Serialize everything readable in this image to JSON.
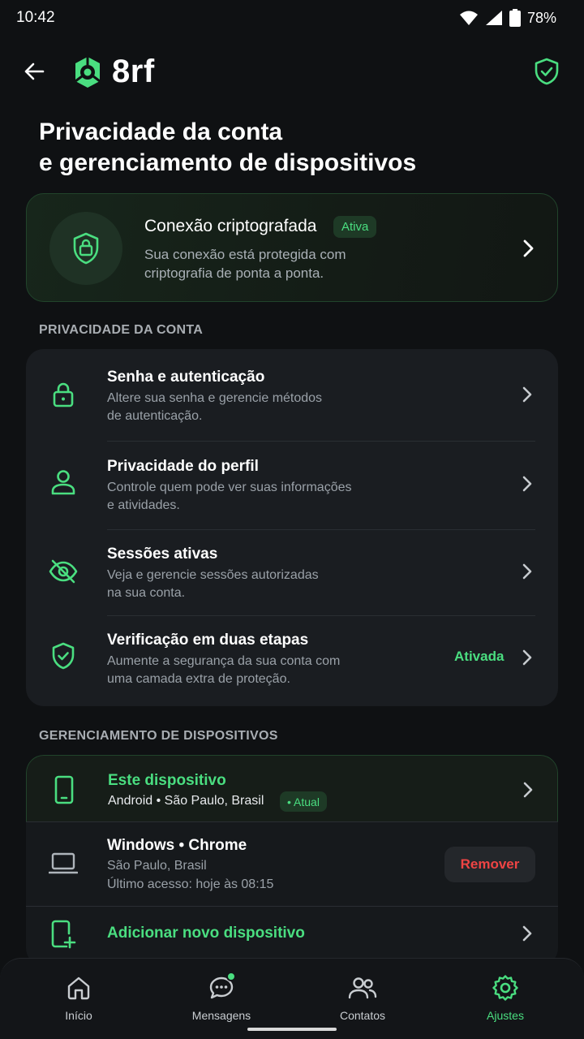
{
  "status_bar": {
    "time": "10:42",
    "battery": "78%"
  },
  "header": {
    "brand": "8rf"
  },
  "page": {
    "title_line1": "Privacidade da conta",
    "title_line2": "e gerenciamento de dispositivos"
  },
  "encryption": {
    "title": "Conexão criptografada",
    "badge": "Ativa",
    "desc_line1": "Sua conexão está protegida com",
    "desc_line2": "criptografia de ponta a ponta."
  },
  "privacy_section": {
    "label": "PRIVACIDADE DA CONTA",
    "items": [
      {
        "title": "Senha e autenticação",
        "desc_line1": "Altere sua senha e gerencie métodos",
        "desc_line2": "de autenticação.",
        "icon": "lock-icon"
      },
      {
        "title": "Privacidade do perfil",
        "desc_line1": "Controle quem pode ver suas informações",
        "desc_line2": "e atividades.",
        "icon": "user-icon"
      },
      {
        "title": "Sessões ativas",
        "desc_line1": "Veja e gerencie sessões autorizadas",
        "desc_line2": "na sua conta.",
        "icon": "eye-off-icon"
      },
      {
        "title": "Verificação em duas etapas",
        "desc_line1": "Aumente a segurança da sua conta com",
        "desc_line2": "uma camada extra de proteção.",
        "icon": "shield-check-icon",
        "status": "Ativada"
      }
    ]
  },
  "devices_section": {
    "label": "GERENCIAMENTO DE DISPOSITIVOS",
    "this_device": {
      "title": "Este dispositivo",
      "subtitle": "Android • São Paulo, Brasil",
      "badge": "• Atual"
    },
    "other_device": {
      "title": "Windows • Chrome",
      "location": "São Paulo, Brasil",
      "last_access": "Último acesso: hoje às 08:15",
      "remove_label": "Remover"
    },
    "add_label": "Adicionar novo dispositivo"
  },
  "bottom_nav": {
    "items": [
      {
        "label": "Início",
        "icon": "home-icon"
      },
      {
        "label": "Mensagens",
        "icon": "chat-icon"
      },
      {
        "label": "Contatos",
        "icon": "contacts-icon"
      },
      {
        "label": "Ajustes",
        "icon": "gear-icon",
        "active": true
      }
    ]
  },
  "colors": {
    "accent": "#4ade80",
    "danger": "#ef4444",
    "background": "#0f1113",
    "card": "#1a1d21"
  }
}
